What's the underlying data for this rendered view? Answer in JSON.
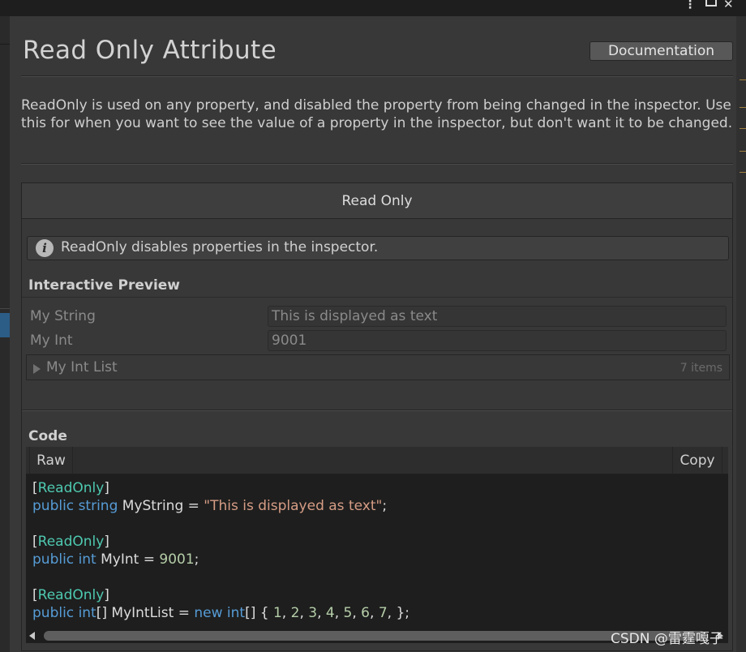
{
  "window": {
    "controls": {
      "kebab": "⋮",
      "maximize": "",
      "close": "✕"
    }
  },
  "header": {
    "title": "Read Only Attribute",
    "documentation_label": "Documentation"
  },
  "description": "ReadOnly is used on any property, and disabled the property from being changed in the inspector. Use this for when you want to see the value of a property in the inspector, but don't want it to be changed.",
  "demo": {
    "header": "Read Only",
    "help_icon": "info-icon",
    "help_text": "ReadOnly disables properties in the inspector.",
    "preview_label": "Interactive Preview",
    "fields": [
      {
        "label": "My String",
        "value": "This is displayed as text"
      },
      {
        "label": "My Int",
        "value": "9001"
      }
    ],
    "list": {
      "label": "My Int List",
      "count": "7 items"
    },
    "code_label": "Code",
    "code_tabs": {
      "raw": "Raw",
      "copy": "Copy"
    },
    "code_tokens": {
      "line1_attr": "ReadOnly",
      "line2_kw": "public",
      "line2_type": "string",
      "line2_name": " MyString = ",
      "line2_str": "\"This is displayed as text\"",
      "line2_end": ";",
      "line4_attr": "ReadOnly",
      "line5_kw": "public",
      "line5_type": "int",
      "line5_name": " MyInt = ",
      "line5_num": "9001",
      "line5_end": ";",
      "line7_attr": "ReadOnly",
      "line8_kw": "public",
      "line8_type": "int",
      "line8_name": "[] MyIntList = ",
      "line8_new": "new",
      "line8_type2": "int",
      "line8_open": "[] { ",
      "line8_nums": [
        "1",
        "2",
        "3",
        "4",
        "5",
        "6",
        "7"
      ],
      "line8_end": " };"
    }
  },
  "watermark": "CSDN @雷霆嘎子",
  "colors": {
    "background": "#383838",
    "keyword": "#569cd6",
    "type": "#4ec9b0",
    "string": "#d69d85",
    "number": "#b5cea8",
    "selection": "#2c5d87"
  }
}
